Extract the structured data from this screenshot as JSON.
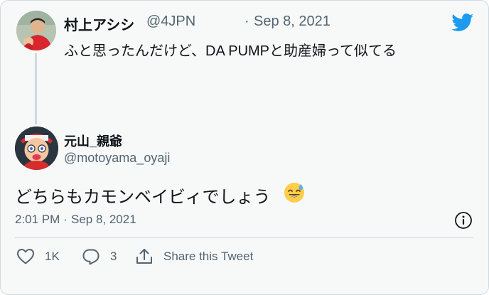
{
  "reply_to": {
    "display_name": "村上アシシ",
    "handle": "@4JPN",
    "separator": "·",
    "date": "Sep 8, 2021",
    "text": "ふと思ったんだけど、DA PUMPと助産婦って似てる",
    "avatar": "person-photo"
  },
  "tweet": {
    "display_name": "元山_親爺",
    "handle": "@motoyama_oyaji",
    "text": "どちらもカモンベイビィでしょう",
    "emoji": "sweat-smile-emoji",
    "time": "2:01 PM",
    "separator": "·",
    "date": "Sep 8, 2021",
    "avatar": "cartoon-avatar"
  },
  "actions": {
    "like_count": "1K",
    "reply_count": "3",
    "share_label": "Share this Tweet"
  },
  "colors": {
    "brand": "#1d9bf0",
    "text": "#0f1419",
    "muted": "#536471",
    "border": "#cfd9de",
    "background": "#f7f9f9"
  },
  "icons": [
    "twitter-bird-icon",
    "info-icon",
    "heart-icon",
    "reply-icon",
    "share-icon"
  ]
}
